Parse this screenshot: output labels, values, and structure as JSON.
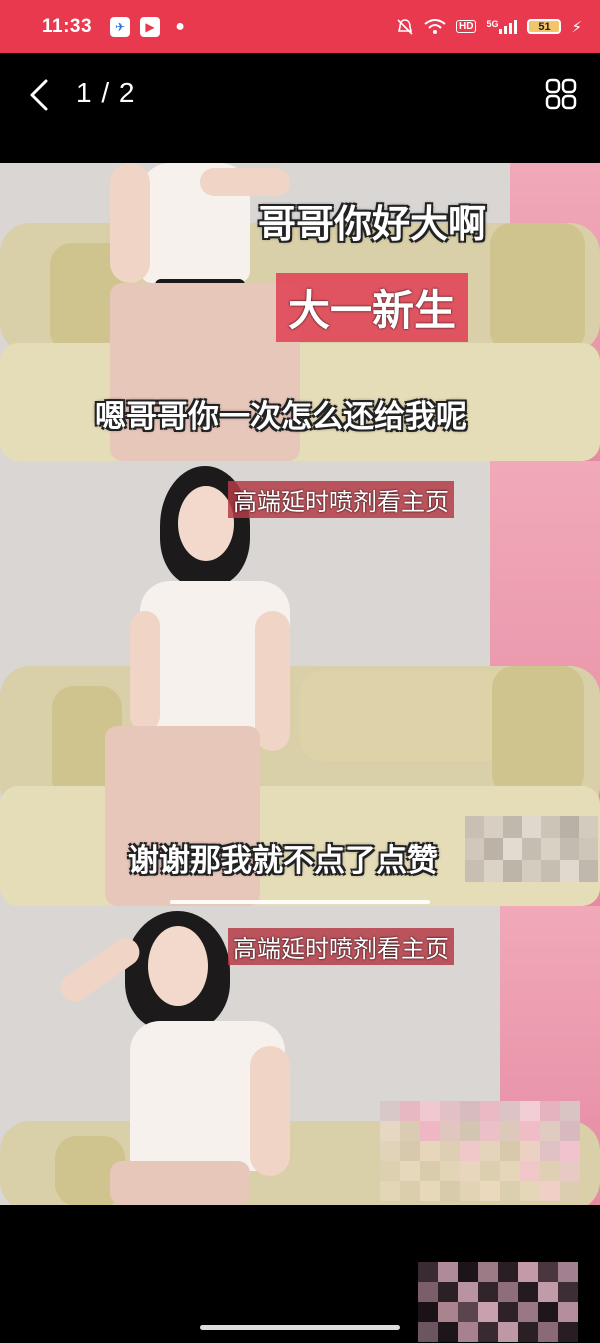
{
  "status_bar": {
    "time": "11:33",
    "hd": "HD",
    "network": "5G",
    "battery": "51",
    "icons": [
      "bird-app-icon",
      "video-app-icon",
      "wechat-icon",
      "mute-bell-icon",
      "wifi-icon",
      "hd-icon",
      "signal-icon",
      "battery-icon",
      "charging-icon"
    ],
    "background_color": "#e9394f"
  },
  "viewer": {
    "page_counter": "1 / 2",
    "back_icon": "chevron-left-icon",
    "grid_icon": "grid-view-icon"
  },
  "panels": [
    {
      "captions": {
        "top": "哥哥你好大啊",
        "tag": "大一新生",
        "subtitle": "嗯哥哥你一次怎么还给我呢"
      }
    },
    {
      "captions": {
        "ad": "高端延时喷剂看主页",
        "subtitle": "谢谢那我就不点了点赞"
      }
    },
    {
      "captions": {
        "ad": "高端延时喷剂看主页"
      }
    }
  ],
  "colors": {
    "accent_red": "#e9394f",
    "caption_red": "#e04a5a",
    "wall_pink": "#e58aa3",
    "sofa": "#d9cfa9"
  }
}
